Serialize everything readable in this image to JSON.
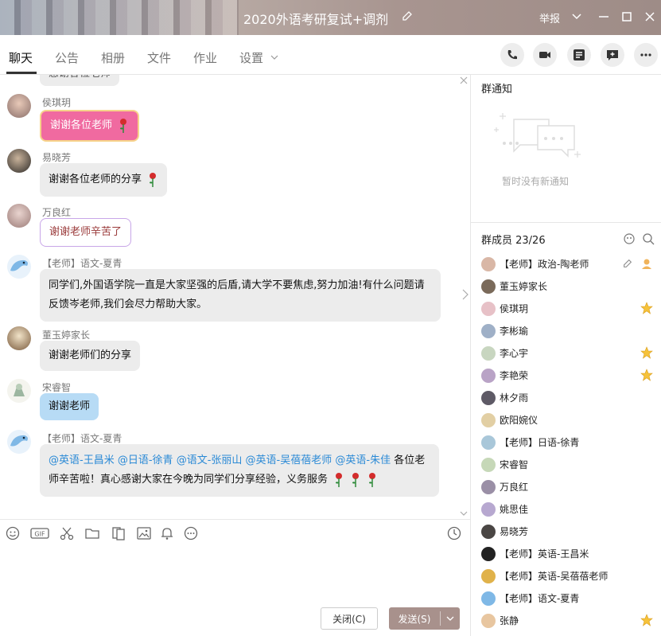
{
  "window": {
    "title": "2020外语考研复试+调剂",
    "report_label": "举报"
  },
  "tabs": [
    "聊天",
    "公告",
    "相册",
    "文件",
    "作业",
    "设置"
  ],
  "messages": [
    {
      "sender": "",
      "text": "感谢各位老师"
    },
    {
      "sender": "侯琪玥",
      "text": "谢谢各位老师"
    },
    {
      "sender": "易晓芳",
      "text": "谢谢各位老师的分享"
    },
    {
      "sender": "万良红",
      "text": "谢谢老师辛苦了"
    },
    {
      "sender": "【老师】语文-夏青",
      "text": "同学们,外国语学院一直是大家坚强的后盾,请大学不要焦虑,努力加油!有什么问题请反馈岑老师,我们会尽力帮助大家。"
    },
    {
      "sender": "董玉婷家长",
      "text": "谢谢老师们的分享"
    },
    {
      "sender": "宋睿智",
      "text": "谢谢老师"
    },
    {
      "sender": "【老师】语文-夏青",
      "mentions": [
        "@英语-王昌米",
        "@日语-徐青",
        "@语文-张丽山",
        "@英语-吴蓓蓓老师",
        "@英语-朱佳"
      ],
      "text_a": "各位老",
      "text_b": "师辛苦啦！真心感谢大家在今晚为同学们分享经验，义务服务"
    }
  ],
  "composer": {
    "close_label": "关闭(C)",
    "send_label": "发送(S)"
  },
  "notice": {
    "title": "群通知",
    "empty_text": "暂时没有新通知"
  },
  "members": {
    "title": "群成员 23/26",
    "list": [
      {
        "name": "【老师】政治-陶老师",
        "star": false
      },
      {
        "name": "董玉婷家长",
        "star": false
      },
      {
        "name": "侯琪玥",
        "star": true
      },
      {
        "name": "李彬瑜",
        "star": false
      },
      {
        "name": "李心宇",
        "star": true
      },
      {
        "name": "李艳荣",
        "star": true
      },
      {
        "name": "林夕雨",
        "star": false
      },
      {
        "name": "欧阳婉仪",
        "star": false
      },
      {
        "name": "【老师】日语-徐青",
        "star": false
      },
      {
        "name": "宋睿智",
        "star": false
      },
      {
        "name": "万良红",
        "star": false
      },
      {
        "name": "姚思佳",
        "star": false
      },
      {
        "name": "易晓芳",
        "star": false
      },
      {
        "name": "【老师】英语-王昌米",
        "star": false
      },
      {
        "name": "【老师】英语-吴蓓蓓老师",
        "star": false
      },
      {
        "name": "【老师】语文-夏青",
        "star": false
      },
      {
        "name": "张静",
        "star": true
      }
    ]
  },
  "colors": {
    "accent": "#a8918c",
    "mention": "#2b8ad6",
    "pink_bubble": "#f06aa0",
    "blue_bubble": "#b7dbf5"
  }
}
